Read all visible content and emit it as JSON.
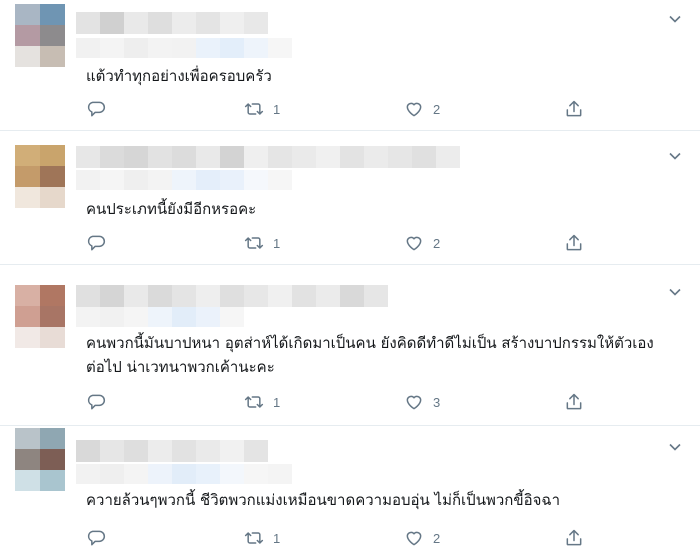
{
  "tweets": [
    {
      "text": "แต้วทำทุกอย่างเพื่อครอบครัว",
      "replies": "",
      "retweets": "1",
      "likes": "2"
    },
    {
      "text": "คนประเภทนี้ยังมีอีกหรอคะ",
      "replies": "",
      "retweets": "1",
      "likes": "2"
    },
    {
      "text": "คนพวกนี้มันบาปหนา อุตส่าห์ได้เกิดมาเป็นคน ยังคิดดีทำดีไม่เป็น สร้างบาปกรรมให้ตัวเองต่อไป น่าเวทนาพวกเค้านะคะ",
      "replies": "",
      "retweets": "1",
      "likes": "3"
    },
    {
      "text": "ควายล้วนๆพวกนี้ ชีวิตพวกแม่งเหมือนขาดความอบอุ่น ไม่ก็เป็นพวกขี้อิจฉา",
      "replies": "",
      "retweets": "1",
      "likes": "2"
    }
  ],
  "icons": {
    "reply": "reply-icon",
    "retweet": "retweet-icon",
    "like": "heart-icon",
    "share": "share-icon",
    "more": "chevron-down-icon"
  },
  "colors": {
    "action_gray": "#657786",
    "divider": "#e6ecf0",
    "text": "#14171a"
  }
}
